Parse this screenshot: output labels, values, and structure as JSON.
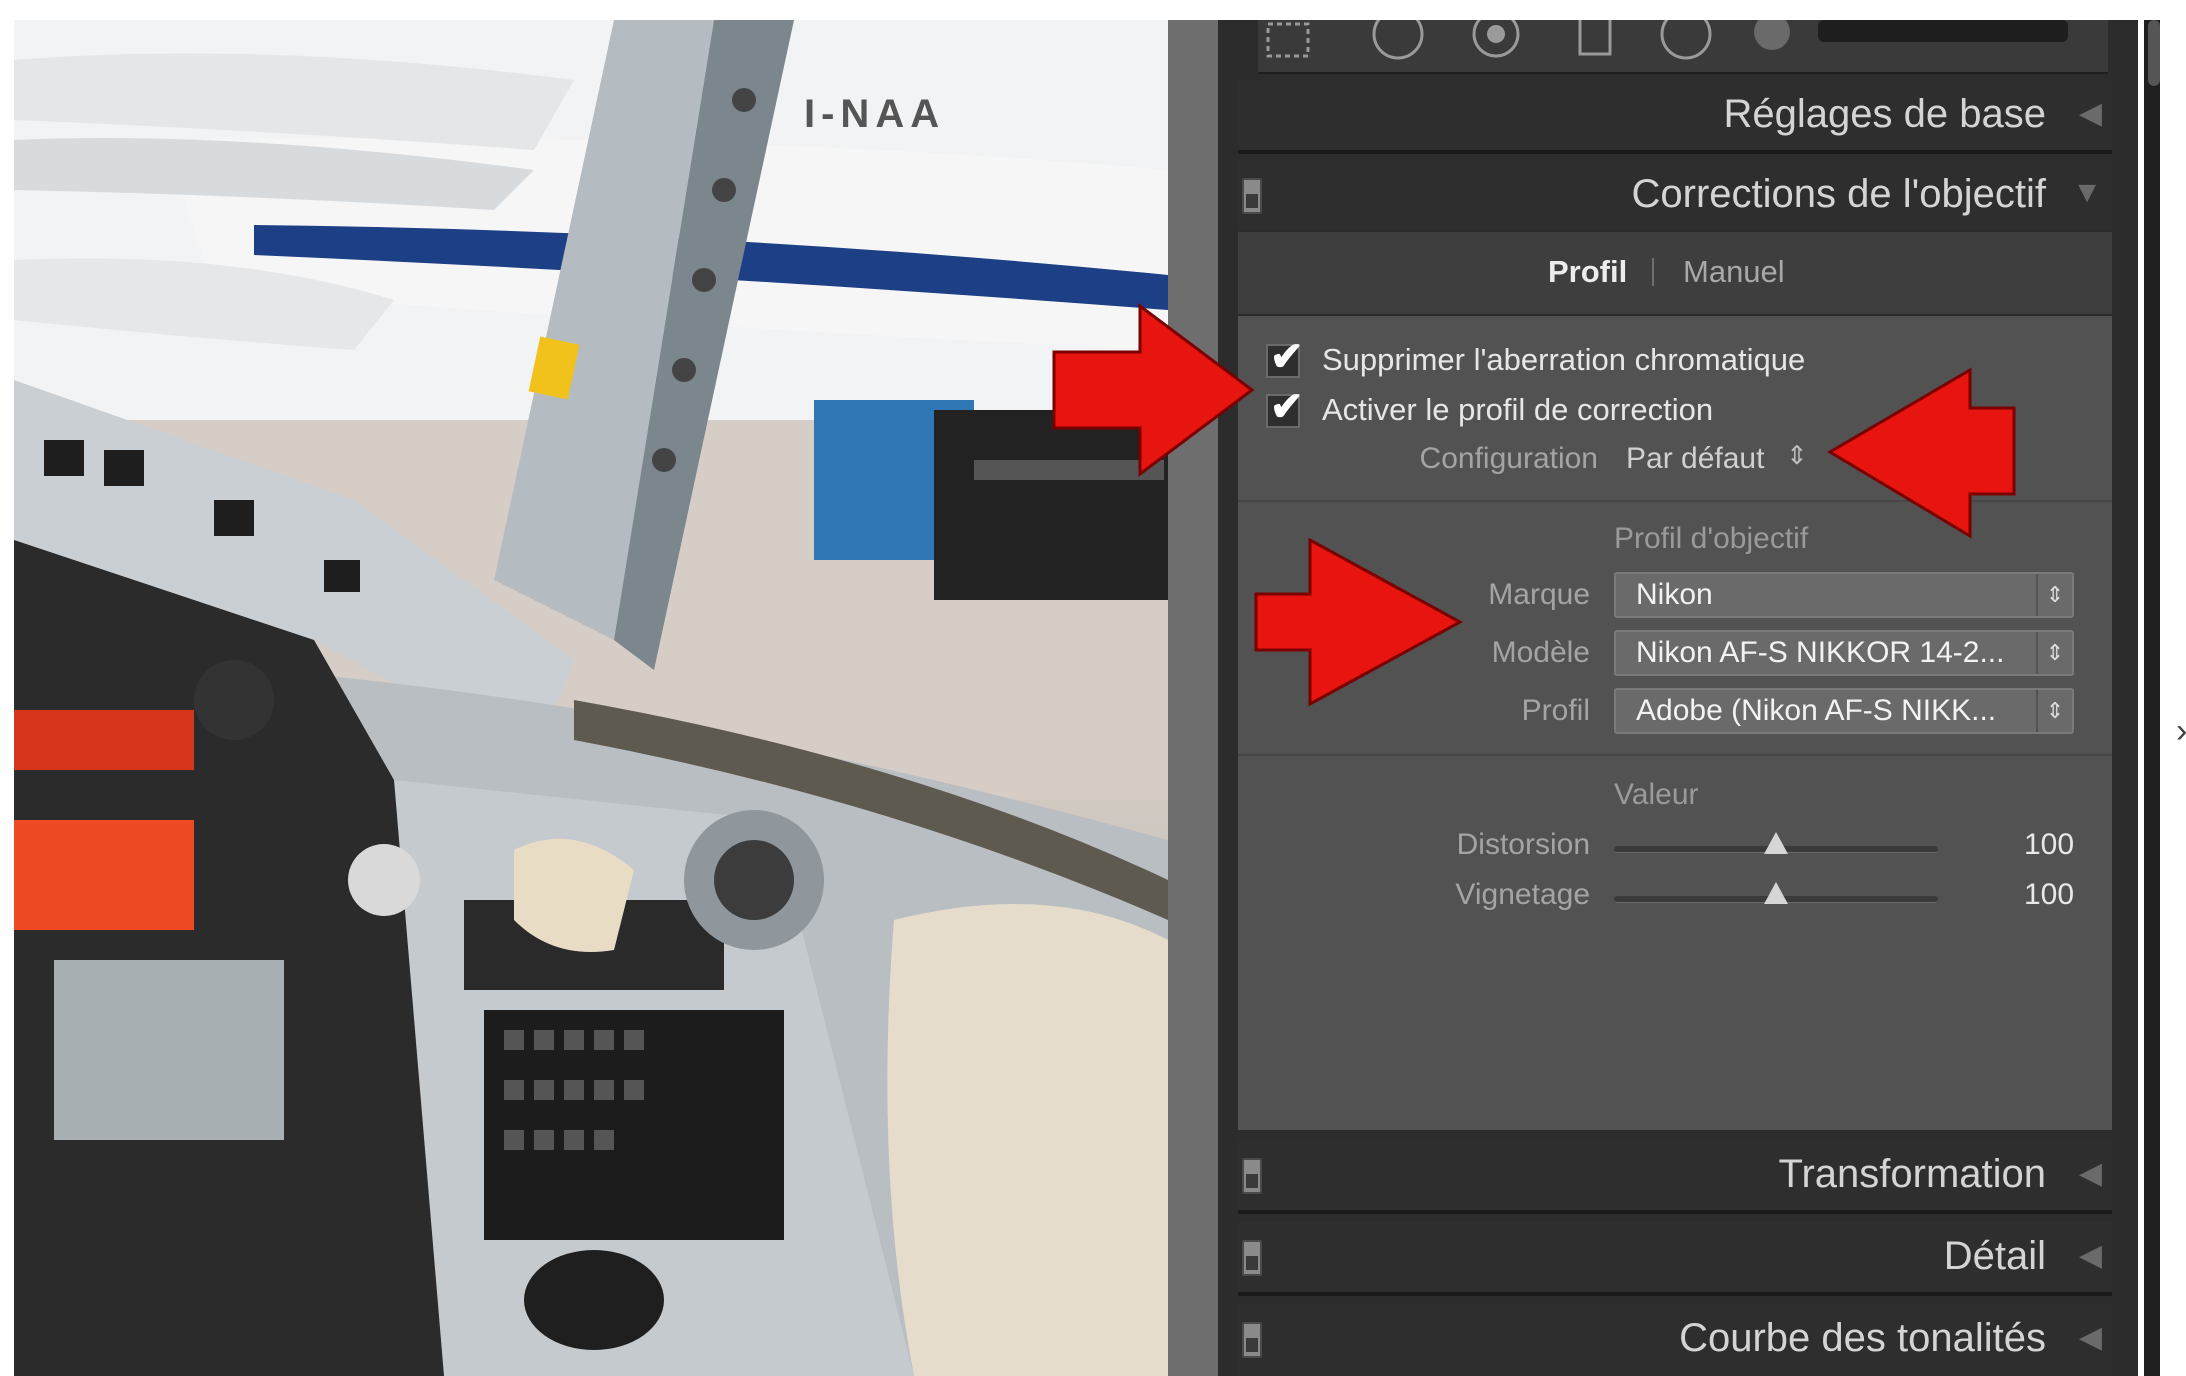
{
  "photo": {
    "registration_text": "I-NAA"
  },
  "panel": {
    "sections": {
      "basic": {
        "title": "Réglages de base",
        "indicator": "◀"
      },
      "lens": {
        "title": "Corrections de l'objectif",
        "indicator": "▼"
      },
      "transform": {
        "title": "Transformation",
        "indicator": "◀"
      },
      "detail": {
        "title": "Détail",
        "indicator": "◀"
      },
      "tone_curve": {
        "title": "Courbe des tonalités",
        "indicator": "◀"
      }
    },
    "lens_tabs": {
      "profil": "Profil",
      "manuel": "Manuel"
    },
    "options": {
      "remove_ca": {
        "label": "Supprimer l'aberration chromatique",
        "checked": true
      },
      "enable_profile": {
        "label": "Activer le profil de correction",
        "checked": true
      }
    },
    "setup": {
      "label": "Configuration",
      "value": "Par défaut",
      "arrow": "⇕"
    },
    "lens_profile": {
      "heading": "Profil d'objectif",
      "make": {
        "label": "Marque",
        "value": "Nikon"
      },
      "model": {
        "label": "Modèle",
        "value": "Nikon AF-S NIKKOR 14-2..."
      },
      "profile": {
        "label": "Profil",
        "value": "Adobe (Nikon AF-S NIKK..."
      }
    },
    "amount": {
      "heading": "Valeur",
      "distortion": {
        "label": "Distorsion",
        "value": "100"
      },
      "vignetting": {
        "label": "Vignetage",
        "value": "100"
      }
    }
  },
  "colors": {
    "panel_bg": "#2c2c2c",
    "section_bg": "#525252",
    "annotation_arrow": "#e8140f"
  },
  "icons": [
    "crop-icon",
    "spot-removal-icon",
    "red-eye-icon",
    "graduated-filter-icon",
    "radial-filter-icon",
    "adjustment-brush-icon",
    "toggle-switch-icon",
    "checkbox-check-icon",
    "select-arrow-icon",
    "collapse-triangle-icon",
    "expand-triangle-icon"
  ]
}
